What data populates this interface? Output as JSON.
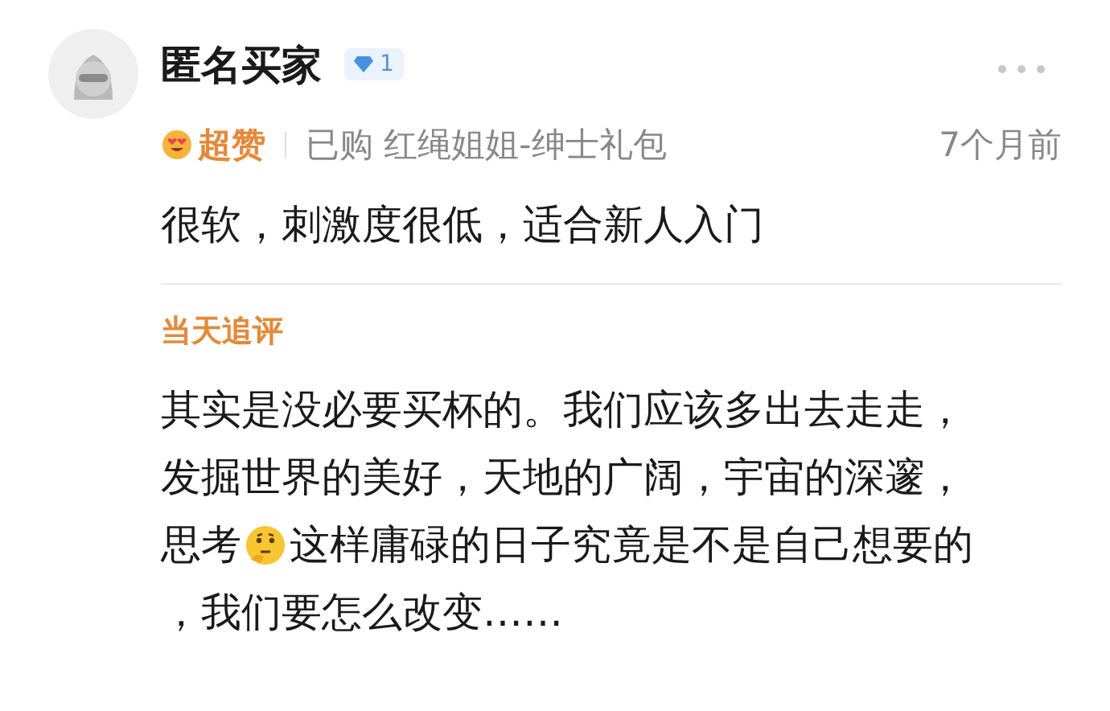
{
  "review": {
    "user": {
      "name": "匿名买家",
      "level_badge": "1"
    },
    "rating_label": "超赞",
    "purchase": "已购 红绳姐姐-绅士礼包",
    "time": "7个月前",
    "comment": "很软，刺激度很低，适合新人入门"
  },
  "follow_up": {
    "title": "当天追评",
    "lines": [
      {
        "segments": [
          "其实是没必要买杯的。我们应该多出去走走，"
        ]
      },
      {
        "segments": [
          "发掘世界的美好，天地的广阔，宇宙的深邃，"
        ]
      },
      {
        "segments": [
          "思考",
          "这样庸碌的日子究竟是不是自己想要的"
        ]
      },
      {
        "segments": [
          "，我们要怎么改变……"
        ]
      }
    ]
  }
}
